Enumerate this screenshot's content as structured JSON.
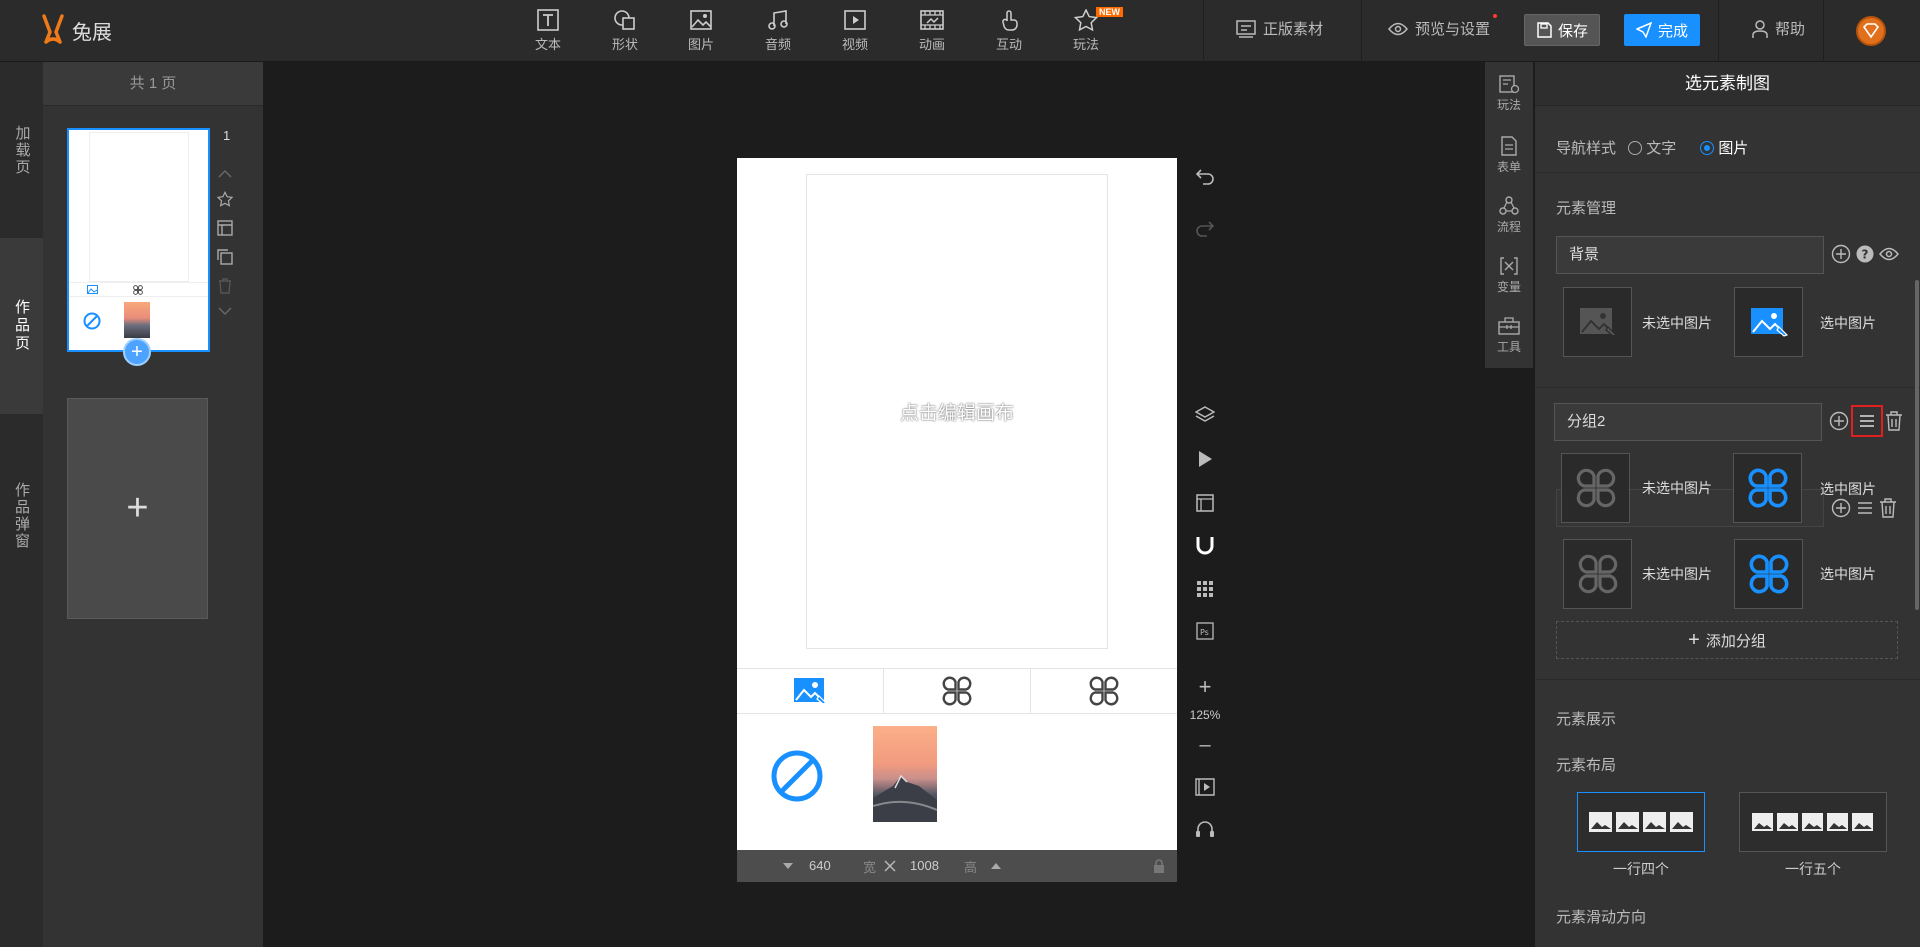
{
  "app": {
    "logo_text": "兔展"
  },
  "toolbar": {
    "items": [
      {
        "label": "文本",
        "icon": "text-icon"
      },
      {
        "label": "形状",
        "icon": "shape-icon"
      },
      {
        "label": "图片",
        "icon": "image-icon"
      },
      {
        "label": "音频",
        "icon": "audio-icon"
      },
      {
        "label": "视频",
        "icon": "video-icon"
      },
      {
        "label": "动画",
        "icon": "animation-icon"
      },
      {
        "label": "互动",
        "icon": "interaction-icon"
      },
      {
        "label": "玩法",
        "icon": "gameplay-icon",
        "badge": "NEW"
      }
    ],
    "licensed_assets": "正版素材",
    "preview_settings": "预览与设置",
    "save": "保存",
    "done": "完成",
    "help": "帮助"
  },
  "left_nav": {
    "items": [
      "加载页",
      "作品页",
      "作品弹窗"
    ],
    "active": "作品页"
  },
  "page_panel": {
    "header": "共 1 页",
    "page_number": "1",
    "add_page": "+"
  },
  "canvas": {
    "hint": "点击编辑画布",
    "zoom": "125%",
    "width": "640",
    "width_unit": "宽",
    "height": "1008",
    "height_unit": "高"
  },
  "side_tabs": [
    "玩法",
    "表单",
    "流程",
    "变量",
    "工具"
  ],
  "props": {
    "title": "选元素制图",
    "nav_style_label": "导航样式",
    "nav_style_options": [
      "文字",
      "图片"
    ],
    "nav_style_selected": "图片",
    "element_mgmt_label": "元素管理",
    "groups": [
      {
        "name": "背景",
        "unselected": "未选中图片",
        "selected": "选中图片"
      },
      {
        "name": "分组2",
        "unselected": "未选中图片",
        "selected": "选中图片"
      },
      {
        "name": "",
        "unselected": "未选中图片",
        "selected": "选中图片"
      }
    ],
    "add_group": "添加分组",
    "element_display": "元素展示",
    "element_layout": "元素布局",
    "layout_options": [
      "一行四个",
      "一行五个"
    ],
    "layout_selected": "一行四个",
    "scroll_direction": "元素滑动方向"
  },
  "colors": {
    "accent": "#1890ff",
    "new_badge": "#ff6a00",
    "highlight": "#e02020"
  }
}
